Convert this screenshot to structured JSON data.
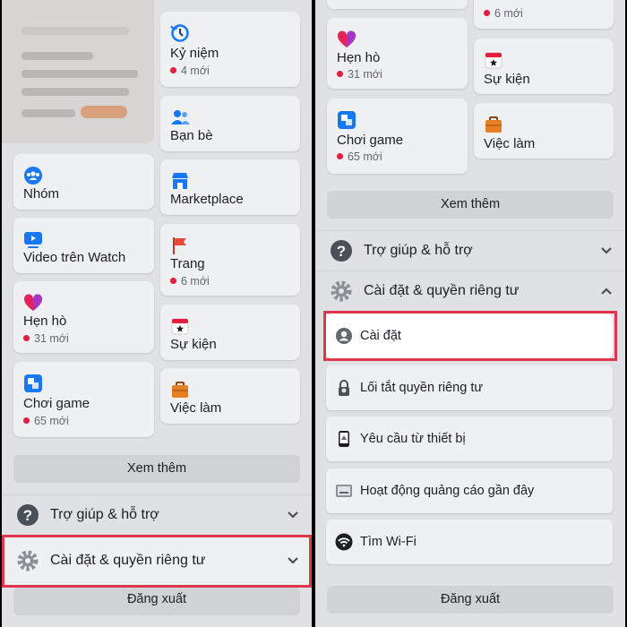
{
  "left": {
    "cards_left": [
      {
        "label": "Nhóm",
        "sub": ""
      },
      {
        "label": "Video trên Watch",
        "sub": ""
      },
      {
        "label": "Hẹn hò",
        "sub": "31 mới"
      },
      {
        "label": "Chơi game",
        "sub": "65 mới"
      }
    ],
    "cards_right": [
      {
        "label": "Kỷ niệm",
        "sub": "4 mới"
      },
      {
        "label": "Bạn bè",
        "sub": ""
      },
      {
        "label": "Marketplace",
        "sub": ""
      },
      {
        "label": "Trang",
        "sub": "6 mới"
      },
      {
        "label": "Sự kiện",
        "sub": ""
      },
      {
        "label": "Việc làm",
        "sub": ""
      }
    ],
    "see_more": "Xem thêm",
    "help": "Trợ giúp & hỗ trợ",
    "settings": "Cài đặt & quyền riêng tư",
    "logout": "Đăng xuất"
  },
  "right": {
    "top_sub": "6 mới",
    "cards_left": [
      {
        "label": "Hẹn hò",
        "sub": "31 mới"
      },
      {
        "label": "Chơi game",
        "sub": "65 mới"
      }
    ],
    "cards_right": [
      {
        "label": "Sự kiện",
        "sub": ""
      },
      {
        "label": "Việc làm",
        "sub": ""
      }
    ],
    "see_more": "Xem thêm",
    "help": "Trợ giúp & hỗ trợ",
    "settings": "Cài đặt & quyền riêng tư",
    "sub_items": [
      {
        "label": "Cài đặt",
        "icon": "user-circle-icon"
      },
      {
        "label": "Lối tắt quyền riêng tư",
        "icon": "lock-icon"
      },
      {
        "label": "Yêu cầu từ thiết bị",
        "icon": "phone-icon"
      },
      {
        "label": "Hoạt động quảng cáo gần đây",
        "icon": "ad-activity-icon"
      },
      {
        "label": "Tìm Wi-Fi",
        "icon": "wifi-icon"
      }
    ],
    "logout": "Đăng xuất"
  },
  "colors": {
    "highlight": "#e0354b",
    "badge_dot": "#e41e3f",
    "accent_blue": "#1877f2"
  }
}
